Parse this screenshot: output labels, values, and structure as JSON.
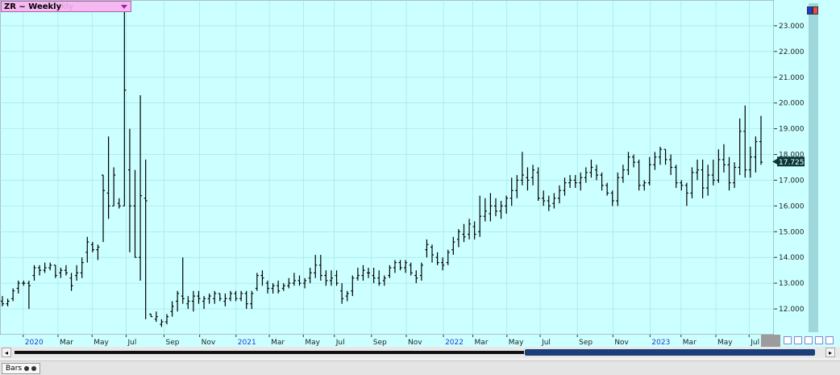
{
  "header": {
    "symbol_label": "ZR ~ Weekly",
    "symbol_ghost": "kly"
  },
  "status": {
    "tab_label": "Bars"
  },
  "colors": {
    "plot_bg": "#ccffff",
    "bar_color": "#000000",
    "grid_color": "#9fe0e6",
    "x_label_year": "#1e3cd2",
    "x_label_month": "#222222",
    "last_price_bg": "#0a3a38",
    "last_price_fg": "#ffffff",
    "right_strip": "#9ed8dc",
    "scroll_thumb": "#1c3f7a",
    "symbol_bg": "#f5b8f0"
  },
  "icons": [
    "dropdown-arrow-icon",
    "scroll-left-icon",
    "scroll-right-icon",
    "nav-buttons-icon",
    "bars-tab-icon"
  ],
  "chart_data": {
    "type": "ohlc",
    "ylim": [
      11.0,
      24.0
    ],
    "y_ticks": [
      "12.000",
      "13.000",
      "14.000",
      "15.000",
      "16.000",
      "17.000",
      "18.000",
      "19.000",
      "20.000",
      "21.000",
      "22.000",
      "23.000"
    ],
    "x_labels": [
      {
        "text": "2020",
        "year": true,
        "pos": 0.03
      },
      {
        "text": "Mar",
        "year": false,
        "pos": 0.075
      },
      {
        "text": "May",
        "year": false,
        "pos": 0.119
      },
      {
        "text": "Jul",
        "year": false,
        "pos": 0.163
      },
      {
        "text": "Sep",
        "year": false,
        "pos": 0.212
      },
      {
        "text": "Nov",
        "year": false,
        "pos": 0.258
      },
      {
        "text": "2021",
        "year": true,
        "pos": 0.305
      },
      {
        "text": "Mar",
        "year": false,
        "pos": 0.348
      },
      {
        "text": "May",
        "year": false,
        "pos": 0.392
      },
      {
        "text": "Jul",
        "year": false,
        "pos": 0.432
      },
      {
        "text": "Sep",
        "year": false,
        "pos": 0.48
      },
      {
        "text": "Nov",
        "year": false,
        "pos": 0.525
      },
      {
        "text": "2022",
        "year": true,
        "pos": 0.573
      },
      {
        "text": "Mar",
        "year": false,
        "pos": 0.611
      },
      {
        "text": "May",
        "year": false,
        "pos": 0.655
      },
      {
        "text": "Jul",
        "year": false,
        "pos": 0.698
      },
      {
        "text": "Sep",
        "year": false,
        "pos": 0.746
      },
      {
        "text": "Nov",
        "year": false,
        "pos": 0.792
      },
      {
        "text": "2023",
        "year": true,
        "pos": 0.84
      },
      {
        "text": "Mar",
        "year": false,
        "pos": 0.88
      },
      {
        "text": "May",
        "year": false,
        "pos": 0.925
      },
      {
        "text": "Jul",
        "year": false,
        "pos": 0.968
      }
    ],
    "last_price": "17.725",
    "last_value": 17.725,
    "ohlc": [
      [
        12.3,
        12.5,
        12.1,
        12.2
      ],
      [
        12.2,
        12.4,
        12.1,
        12.3
      ],
      [
        12.4,
        12.8,
        12.3,
        12.7
      ],
      [
        12.8,
        13.1,
        12.6,
        13.0
      ],
      [
        13.0,
        13.1,
        12.9,
        13.0
      ],
      [
        13.0,
        13.1,
        12.0,
        12.9
      ],
      [
        13.3,
        13.7,
        13.1,
        13.6
      ],
      [
        13.6,
        13.7,
        13.3,
        13.5
      ],
      [
        13.5,
        13.8,
        13.4,
        13.6
      ],
      [
        13.6,
        13.8,
        13.5,
        13.7
      ],
      [
        13.7,
        13.7,
        13.2,
        13.3
      ],
      [
        13.4,
        13.6,
        13.2,
        13.5
      ],
      [
        13.5,
        13.7,
        13.3,
        13.4
      ],
      [
        13.2,
        13.4,
        12.7,
        12.9
      ],
      [
        13.3,
        13.7,
        13.1,
        13.4
      ],
      [
        13.4,
        14.0,
        13.2,
        13.8
      ],
      [
        14.2,
        14.8,
        13.8,
        14.6
      ],
      [
        14.5,
        14.6,
        14.2,
        14.3
      ],
      [
        14.3,
        14.5,
        13.9,
        14.4
      ],
      [
        17.2,
        17.2,
        14.6,
        16.6
      ],
      [
        16.5,
        18.7,
        15.5,
        16.0
      ],
      [
        16.0,
        17.5,
        16.0,
        17.2
      ],
      [
        16.1,
        16.3,
        15.9,
        16.0
      ],
      [
        16.0,
        23.6,
        16.0,
        20.5
      ],
      [
        17.4,
        19.0,
        14.2,
        16.0
      ],
      [
        16.0,
        17.4,
        14.0,
        14.0
      ],
      [
        14.0,
        20.3,
        13.1,
        16.4
      ],
      [
        16.3,
        17.8,
        11.6,
        16.2
      ],
      [
        11.8,
        11.8,
        11.7,
        11.7
      ],
      [
        11.6,
        11.9,
        11.5,
        11.7
      ],
      [
        11.4,
        11.6,
        11.3,
        11.5
      ],
      [
        11.5,
        11.8,
        11.4,
        11.7
      ],
      [
        11.9,
        12.3,
        11.7,
        12.1
      ],
      [
        12.3,
        12.7,
        11.9,
        12.6
      ],
      [
        12.5,
        14.0,
        12.2,
        12.4
      ],
      [
        12.2,
        12.5,
        12.0,
        12.3
      ],
      [
        12.3,
        12.7,
        11.9,
        12.5
      ],
      [
        12.5,
        12.7,
        12.2,
        12.4
      ],
      [
        12.3,
        12.5,
        12.0,
        12.4
      ],
      [
        12.4,
        12.6,
        12.2,
        12.5
      ],
      [
        12.4,
        12.7,
        12.2,
        12.6
      ],
      [
        12.6,
        12.6,
        12.3,
        12.4
      ],
      [
        12.3,
        12.6,
        12.1,
        12.4
      ],
      [
        12.4,
        12.7,
        12.3,
        12.6
      ],
      [
        12.6,
        12.7,
        12.3,
        12.4
      ],
      [
        12.4,
        12.7,
        12.3,
        12.6
      ],
      [
        12.6,
        12.7,
        12.0,
        12.2
      ],
      [
        12.2,
        12.7,
        12.0,
        12.6
      ],
      [
        12.8,
        13.4,
        12.7,
        13.3
      ],
      [
        13.3,
        13.5,
        12.9,
        13.2
      ],
      [
        13.0,
        13.1,
        12.6,
        12.8
      ],
      [
        12.8,
        13.0,
        12.6,
        12.9
      ],
      [
        12.9,
        13.1,
        12.6,
        12.7
      ],
      [
        12.8,
        13.0,
        12.7,
        12.9
      ],
      [
        12.9,
        13.2,
        12.8,
        13.0
      ],
      [
        13.0,
        13.4,
        12.9,
        13.1
      ],
      [
        13.1,
        13.3,
        12.9,
        13.0
      ],
      [
        13.0,
        13.2,
        12.8,
        13.1
      ],
      [
        13.2,
        13.6,
        13.0,
        13.4
      ],
      [
        13.4,
        14.1,
        13.2,
        13.7
      ],
      [
        13.7,
        14.1,
        13.1,
        13.3
      ],
      [
        13.3,
        13.5,
        12.9,
        13.1
      ],
      [
        13.1,
        13.5,
        12.9,
        13.2
      ],
      [
        13.3,
        13.5,
        12.9,
        13.0
      ],
      [
        12.7,
        13.0,
        12.2,
        12.4
      ],
      [
        12.5,
        12.7,
        12.3,
        12.6
      ],
      [
        12.7,
        13.3,
        12.5,
        13.2
      ],
      [
        13.2,
        13.6,
        13.1,
        13.3
      ],
      [
        13.3,
        13.7,
        13.1,
        13.5
      ],
      [
        13.4,
        13.6,
        13.2,
        13.4
      ],
      [
        13.3,
        13.6,
        13.0,
        13.2
      ],
      [
        13.2,
        13.5,
        12.9,
        13.0
      ],
      [
        13.1,
        13.3,
        12.9,
        13.2
      ],
      [
        13.3,
        13.7,
        13.2,
        13.6
      ],
      [
        13.6,
        13.9,
        13.4,
        13.8
      ],
      [
        13.8,
        13.9,
        13.5,
        13.6
      ],
      [
        13.6,
        13.9,
        13.4,
        13.8
      ],
      [
        13.7,
        13.8,
        13.3,
        13.4
      ],
      [
        13.3,
        13.5,
        13.0,
        13.2
      ],
      [
        13.3,
        13.8,
        13.1,
        13.7
      ],
      [
        14.3,
        14.7,
        14.0,
        14.5
      ],
      [
        14.4,
        14.5,
        13.8,
        14.1
      ],
      [
        14.0,
        14.2,
        13.7,
        13.8
      ],
      [
        13.8,
        14.0,
        13.5,
        13.7
      ],
      [
        13.8,
        14.3,
        13.7,
        14.2
      ],
      [
        14.3,
        14.8,
        14.1,
        14.6
      ],
      [
        14.7,
        15.1,
        14.4,
        15.0
      ],
      [
        14.9,
        15.3,
        14.6,
        14.8
      ],
      [
        14.9,
        15.5,
        14.7,
        15.3
      ],
      [
        15.2,
        15.4,
        14.7,
        14.9
      ],
      [
        15.0,
        16.4,
        14.8,
        15.6
      ],
      [
        15.6,
        16.3,
        15.4,
        15.8
      ],
      [
        15.7,
        16.5,
        15.4,
        16.0
      ],
      [
        16.0,
        16.3,
        15.6,
        15.8
      ],
      [
        15.8,
        16.2,
        15.5,
        16.0
      ],
      [
        16.0,
        16.4,
        15.7,
        16.3
      ],
      [
        16.3,
        17.1,
        16.0,
        16.6
      ],
      [
        16.6,
        17.2,
        16.3,
        17.0
      ],
      [
        17.0,
        18.1,
        16.8,
        17.2
      ],
      [
        17.1,
        17.5,
        16.6,
        17.0
      ],
      [
        17.1,
        17.6,
        16.8,
        17.4
      ],
      [
        17.3,
        17.5,
        16.2,
        16.3
      ],
      [
        16.3,
        16.6,
        16.0,
        16.2
      ],
      [
        16.2,
        16.4,
        15.8,
        16.0
      ],
      [
        16.1,
        16.5,
        15.9,
        16.3
      ],
      [
        16.3,
        16.8,
        16.1,
        16.6
      ],
      [
        16.6,
        17.1,
        16.4,
        16.9
      ],
      [
        16.9,
        17.2,
        16.7,
        17.0
      ],
      [
        17.0,
        17.2,
        16.7,
        16.9
      ],
      [
        16.9,
        17.3,
        16.6,
        17.1
      ],
      [
        17.1,
        17.5,
        16.9,
        17.3
      ],
      [
        17.3,
        17.8,
        17.1,
        17.5
      ],
      [
        17.4,
        17.6,
        17.0,
        17.2
      ],
      [
        17.2,
        17.3,
        16.6,
        16.8
      ],
      [
        16.8,
        16.9,
        16.4,
        16.5
      ],
      [
        16.5,
        16.6,
        16.0,
        16.2
      ],
      [
        16.2,
        17.3,
        16.0,
        17.1
      ],
      [
        17.1,
        17.6,
        16.9,
        17.4
      ],
      [
        17.4,
        18.1,
        17.2,
        17.9
      ],
      [
        17.9,
        18.0,
        17.5,
        17.7
      ],
      [
        17.7,
        17.8,
        16.6,
        16.8
      ],
      [
        16.8,
        17.0,
        16.6,
        16.9
      ],
      [
        16.9,
        17.9,
        16.8,
        17.6
      ],
      [
        17.6,
        18.1,
        17.4,
        17.9
      ],
      [
        17.9,
        18.3,
        17.6,
        18.2
      ],
      [
        18.2,
        18.2,
        17.6,
        17.8
      ],
      [
        17.8,
        18.0,
        17.2,
        17.5
      ],
      [
        17.5,
        17.6,
        16.7,
        16.9
      ],
      [
        16.9,
        17.0,
        16.6,
        16.8
      ],
      [
        16.8,
        16.9,
        16.0,
        16.5
      ],
      [
        16.5,
        17.5,
        16.3,
        17.3
      ],
      [
        17.3,
        17.8,
        17.0,
        17.4
      ],
      [
        17.4,
        17.8,
        16.3,
        16.7
      ],
      [
        16.7,
        17.6,
        16.4,
        17.2
      ],
      [
        17.2,
        17.8,
        16.8,
        17.0
      ],
      [
        17.0,
        18.2,
        16.9,
        17.8
      ],
      [
        17.8,
        18.4,
        17.3,
        17.6
      ],
      [
        17.6,
        17.9,
        16.6,
        16.9
      ],
      [
        16.9,
        17.7,
        16.7,
        17.5
      ],
      [
        17.5,
        19.4,
        17.2,
        18.9
      ],
      [
        18.9,
        19.9,
        17.1,
        17.4
      ],
      [
        17.4,
        18.3,
        17.1,
        17.9
      ],
      [
        17.9,
        18.7,
        17.3,
        18.5
      ],
      [
        18.5,
        19.5,
        17.6,
        17.7
      ]
    ]
  }
}
